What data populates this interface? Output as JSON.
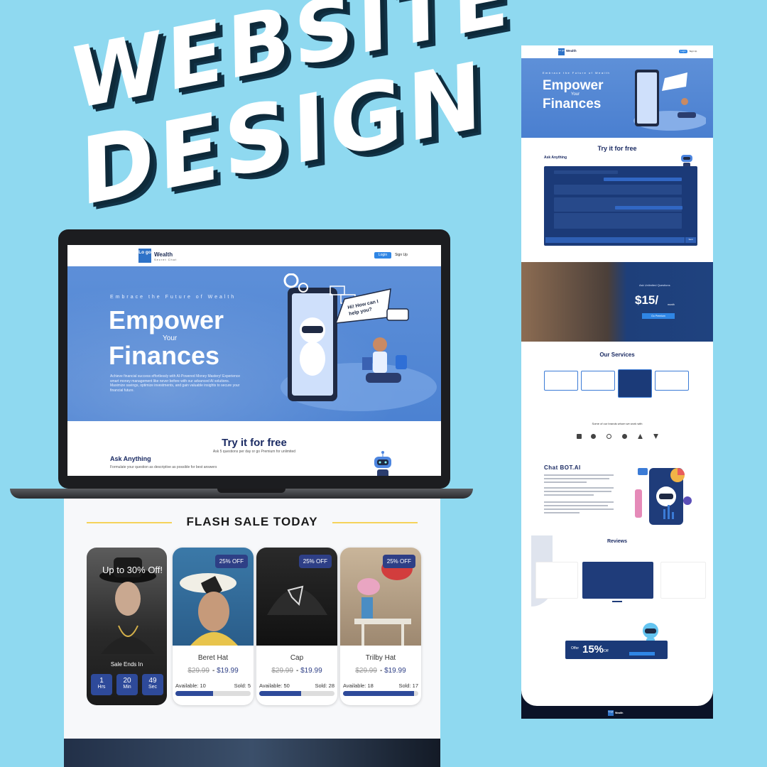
{
  "headline": {
    "line1": "WEBSITE",
    "line2": "DESIGN"
  },
  "laptop": {
    "logo_text": "Lo go",
    "brand_name": "Wealth",
    "brand_sub": "Secret Chat",
    "login_label": "Login",
    "signup_label": "Sign Up",
    "hero_tagline": "Embrace the Future of Wealth",
    "hero_line1": "Empower",
    "hero_your": "Your",
    "hero_line2": "Finances",
    "hero_paragraph": "Achieve financial success effortlessly with AI-Powered Money Mastery! Experience smart money management like never before with our advanced AI solutions. Maximize savings, optimize investments, and gain valuable insights to secure your financial future.",
    "bubble_text": "Hi! How can I help you?",
    "try_title": "Try it for free",
    "try_sub": "Ask 5 questions per day or go Premium for unlimited",
    "ask_title": "Ask Anything",
    "ask_sub": "Formulate your question as descriptive as possible for best answers"
  },
  "flash": {
    "title": "FLASH SALE TODAY",
    "promo_title": "Up to 30% Off!",
    "sale_ends": "Sale Ends In",
    "countdown": [
      {
        "value": "1",
        "unit": "Hrs"
      },
      {
        "value": "20",
        "unit": "Min"
      },
      {
        "value": "49",
        "unit": "Sec"
      }
    ],
    "products": [
      {
        "badge": "25% OFF",
        "name": "Beret Hat",
        "old_price": "$29.99",
        "sep": "-",
        "new_price": "$19.99",
        "available": "Available: 10",
        "sold": "Sold: 5",
        "progress": 0.5
      },
      {
        "badge": "25% OFF",
        "name": "Cap",
        "old_price": "$29.99",
        "sep": "-",
        "new_price": "$19.99",
        "available": "Available: 50",
        "sold": "Sold: 28",
        "progress": 0.56
      },
      {
        "badge": "25% OFF",
        "name": "Trilby Hat",
        "old_price": "$29.99",
        "sep": "-",
        "new_price": "$19.99",
        "available": "Available: 18",
        "sold": "Sold: 17",
        "progress": 0.94
      }
    ]
  },
  "long_page": {
    "logo_text": "Lo go",
    "brand_name": "Wealth",
    "login_label": "Login",
    "signup_label": "Sign Up",
    "hero_tagline": "Embrace the Future of Wealth",
    "hero_line1": "Empower",
    "hero_your": "Your",
    "hero_line2": "Finances",
    "try_title": "Try it for free",
    "ask_title": "Ask Anything",
    "send_label": "Send",
    "ask_unlimited": "Ask Unlimited Questions",
    "price": "$15/",
    "per": "month",
    "go_premium": "Go Premium",
    "services_title": "Our Services",
    "brands_title": "Some of our brands whom we work with",
    "bot_title": "Chat BOT.AI",
    "reviews_title": "Reviews",
    "offer_label": "Offer",
    "offer_value": "15%",
    "offer_suffix": "Off"
  }
}
